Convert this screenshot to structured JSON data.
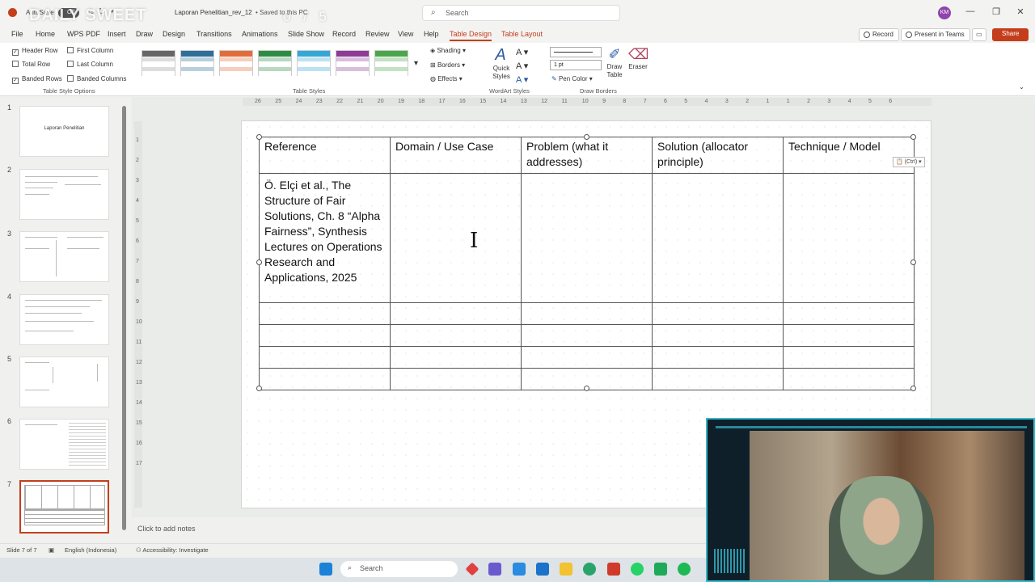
{
  "titlebar": {
    "autosave_label": "AutoSave",
    "autosave_state": "Off",
    "watermark": "DAILY SWEET",
    "watermark_number": "0 7 5",
    "document_title": "Laporan Penelitian_rev_12",
    "save_status": "• Saved to this PC",
    "search_placeholder": "Search",
    "avatar_initials": "KM",
    "minimize_glyph": "—",
    "restore_glyph": "❐",
    "close_glyph": "✕"
  },
  "menu": {
    "items": [
      "File",
      "Home",
      "WPS PDF",
      "Insert",
      "Draw",
      "Design",
      "Transitions",
      "Animations",
      "Slide Show",
      "Record",
      "Review",
      "View",
      "Help",
      "Table Design",
      "Table Layout"
    ],
    "active": "Table Design",
    "record_button": "Record",
    "present_button": "Present in Teams",
    "share_button": "Share"
  },
  "ribbon": {
    "table_style_options": {
      "header_row": "Header Row",
      "total_row": "Total Row",
      "banded_rows": "Banded Rows",
      "first_column": "First Column",
      "last_column": "Last Column",
      "banded_columns": "Banded Columns",
      "group_label": "Table Style Options"
    },
    "table_styles": {
      "group_label": "Table Styles",
      "shading": "Shading",
      "borders": "Borders",
      "effects": "Effects",
      "swatch_colors": [
        "#ffffff",
        "#2e6f99",
        "#e36c3a",
        "#2e8b43",
        "#35a7d6",
        "#8e3a96",
        "#4aa64a"
      ]
    },
    "wordart": {
      "quick_styles": "Quick Styles",
      "group_label": "WordArt Styles"
    },
    "draw_borders": {
      "pen_weight": "1 pt",
      "pen_color": "Pen Color",
      "draw_table": "Draw Table",
      "eraser": "Eraser",
      "group_label": "Draw Borders"
    }
  },
  "thumbnails": {
    "slide_numbers": [
      "1",
      "2",
      "3",
      "4",
      "5",
      "6",
      "7"
    ],
    "slide1_title": "Laporan Penelitian"
  },
  "ruler": {
    "horizontal_ticks": [
      "26",
      "25",
      "24",
      "23",
      "22",
      "21",
      "20",
      "19",
      "18",
      "17",
      "16",
      "15",
      "14",
      "13",
      "12",
      "11",
      "10",
      "9",
      "8",
      "7",
      "6",
      "5",
      "4",
      "3",
      "2",
      "1",
      "1",
      "2",
      "3",
      "4",
      "5",
      "6"
    ],
    "vertical_ticks": [
      "1",
      "2",
      "3",
      "4",
      "5",
      "6",
      "7",
      "8",
      "9",
      "10",
      "11",
      "12",
      "13",
      "14",
      "15",
      "16",
      "17"
    ]
  },
  "table": {
    "headers": [
      "Reference",
      "Domain / Use Case",
      "Problem (what it addresses)",
      "Solution (allocator principle)",
      "Technique / Model"
    ],
    "first_row_reference": "Ö. Elçi et al., The Structure of Fair Solutions, Ch. 8 “Alpha Fairness”, Synthesis Lectures on Operations Research and Applications, 2025",
    "ctrl_tag": "(Ctrl)"
  },
  "notes": {
    "placeholder": "Click to add notes"
  },
  "status": {
    "slide_counter": "Slide 7 of 7",
    "language": "English (Indonesia)",
    "accessibility": "Accessibility: Investigate"
  },
  "taskbar": {
    "search_label": "Search"
  }
}
